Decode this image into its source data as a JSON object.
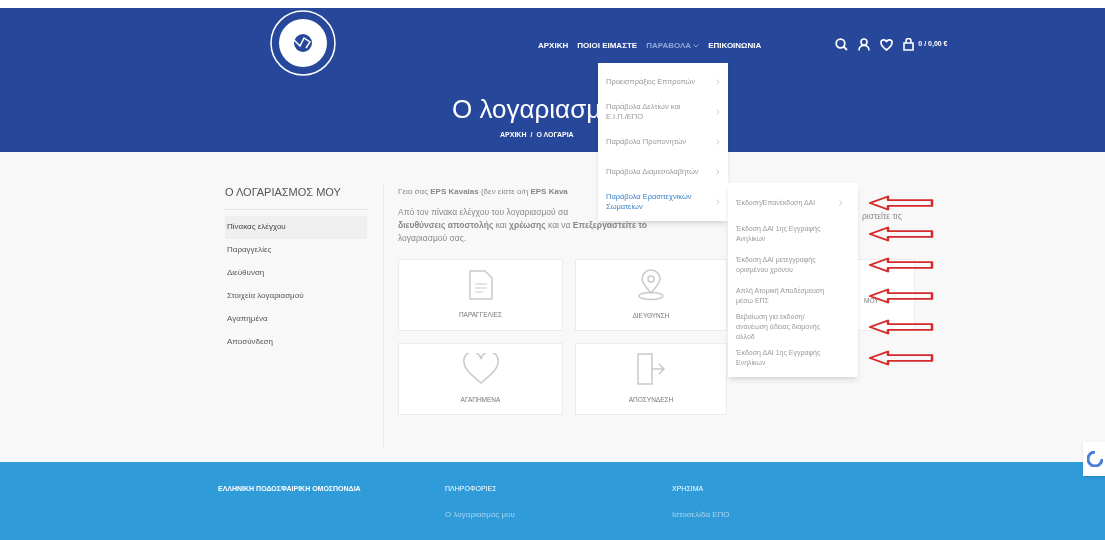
{
  "header": {
    "nav": [
      {
        "label": "ΑΡΧΙΚΗ",
        "selected": false,
        "has_caret": false
      },
      {
        "label": "ΠΟΙΟΙ ΕΙΜΑΣΤΕ",
        "selected": false,
        "has_caret": false
      },
      {
        "label": "ΠΑΡΑΒΟΛΑ",
        "selected": true,
        "has_caret": true
      },
      {
        "label": "ΕΠΙΚΟΙΝΩΝΙΑ",
        "selected": false,
        "has_caret": false
      }
    ],
    "cart": "0 / 0,00 €",
    "title": "Ο λογαριασμ",
    "breadcrumb": [
      "ΑΡΧΙΚΗ",
      "/",
      "Ο ΛΟΓΑΡΙΑ"
    ]
  },
  "dropdown": {
    "items": [
      {
        "label": "Προεισπράξεις Επιτροπών",
        "selected": false
      },
      {
        "label": "Παράβολα Δελτίων και Ε.Ι.Π./ΕΠΟ",
        "selected": false
      },
      {
        "label": "Παράβολα Προπονητών",
        "selected": false
      },
      {
        "label": "Παράβολα Διαμεσολαβητών",
        "selected": false
      },
      {
        "label": "Παράβολα Ερασιτεχνικών Σωματείων",
        "selected": true
      }
    ]
  },
  "submenu": {
    "items": [
      {
        "label": "Έκδοση/Επανέκδοση ΔΑΙ",
        "has_caret": true,
        "marked": true
      },
      {
        "label": "Έκδοση ΔΑΙ 1ης Εγγραφής Ανηλίκων",
        "has_caret": false,
        "marked": true
      },
      {
        "label": "Έκδοση ΔΑΙ μετεγγραφής ορισμένου χρόνου",
        "has_caret": false,
        "marked": true
      },
      {
        "label": "Απλή Ατομική Αποδέσμευση μέσω ΕΠΣ",
        "has_caret": false,
        "marked": true
      },
      {
        "label": "Βεβαίωση για έκδοση/ ανανέωση άδειας διαμονής αλλοδ",
        "has_caret": false,
        "marked": true
      },
      {
        "label": "Έκδοση ΔΑΙ 1ης Εγγραφής Ενηλίκων",
        "has_caret": false,
        "marked": true
      }
    ]
  },
  "sidebar": {
    "title": "Ο ΛΟΓΑΡΙΑΣΜΟΣ ΜΟΥ",
    "items": [
      {
        "label": "Πίνακας ελέγχου",
        "selected": true
      },
      {
        "label": "Παραγγελίες",
        "selected": false
      },
      {
        "label": "Διεύθυνση",
        "selected": false
      },
      {
        "label": "Στοιχεία λογαριασμού",
        "selected": false
      },
      {
        "label": "Αγαπημένα",
        "selected": false
      },
      {
        "label": "Αποσύνδεση",
        "selected": false
      }
    ]
  },
  "main": {
    "greeting": "Γεια σας **EPS Kavalas** (δεν είστε ο/η **EPS Kava**",
    "intro_lines": [
      "Από τον πίνακα ελέγχου του λογαριασμού σα",
      "**διευθύνσεις αποστολής** και **χρέωσης** και να **Επεξεργαστείτε το**",
      "λογαριασμού σας."
    ],
    "intro_tail": "ριστείτε τις",
    "cards": [
      {
        "kind": "document",
        "label": "ΠΑΡΑΓΓΕΛΙΕΣ"
      },
      {
        "kind": "pin",
        "label": "ΔΙΕΥΘΥΝΣΗ"
      },
      {
        "kind": "partial",
        "label": "ΜΟΥ"
      },
      {
        "kind": "heart",
        "label": "ΑΓΑΠΗΜΕΝΑ"
      },
      {
        "kind": "exit",
        "label": "ΑΠΟΣΥΝΔΕΣΗ"
      }
    ]
  },
  "footer": {
    "columns": [
      {
        "heading": "ΕΛΛΗΝΙΚΗ ΠΟΔΟΣΦΑΙΡΙΚΗ ΟΜΟΣΠΟΝΔΙΑ"
      },
      {
        "heading": "ΠΛΗΡΟΦΟΡΙΕΣ",
        "link": "Ο λογαριασμός μου"
      },
      {
        "heading": "ΧΡΗΣΙΜΑ",
        "link": "Ιστοσελίδα ΕΠΟ"
      }
    ]
  }
}
